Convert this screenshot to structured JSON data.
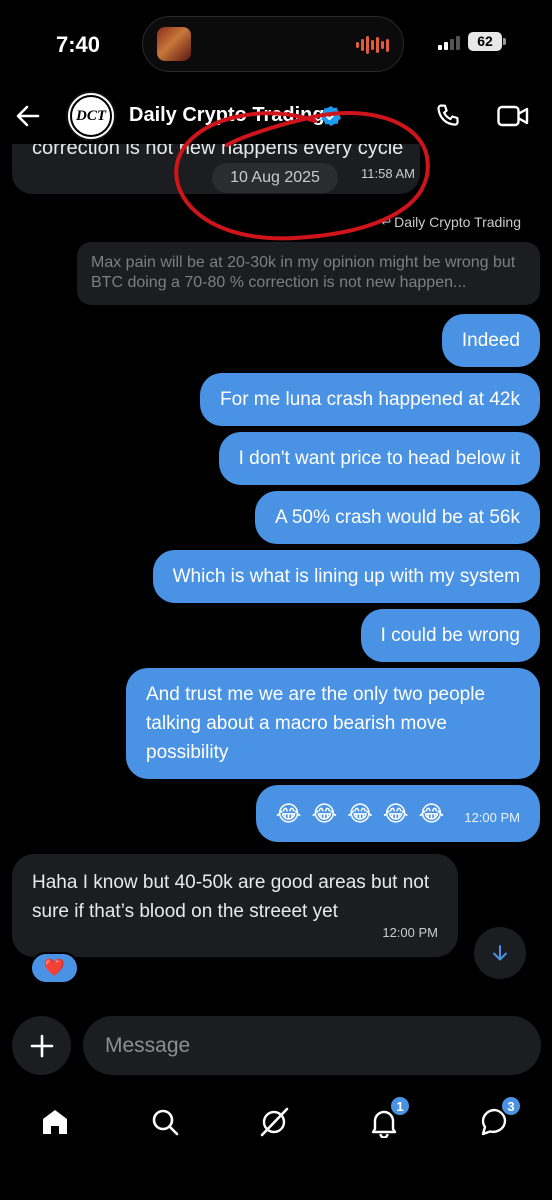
{
  "status_bar": {
    "time": "7:40",
    "battery": "62"
  },
  "header": {
    "back_icon": "back-arrow-icon",
    "avatar_text": "DCT",
    "title": "Daily Crypto Trading",
    "verified_icon": "verified-badge-icon",
    "call_icon": "phone-icon",
    "video_icon": "video-camera-icon"
  },
  "conversation": {
    "previous_message_fragment": "correction is not new happens every cycle",
    "date_separator": "10 Aug 2025",
    "previous_message_time": "11:58 AM",
    "reply": {
      "replying_to": "Daily Crypto Trading",
      "quoted_text": "Max pain will be at 20-30k in my opinion might be wrong but BTC doing a 70-80 % correction is not new happen..."
    },
    "outgoing_messages": [
      "Indeed",
      "For me luna crash happened at 42k",
      "I don't want price to head below it",
      "A 50% crash would be at 56k",
      "Which is what is lining up with my system",
      "I could be wrong",
      "And trust me we are the only two people talking about a macro bearish move possibility"
    ],
    "emoji_message": {
      "emojis": [
        "😂",
        "😂",
        "😂",
        "😂",
        "😂"
      ],
      "time": "12:00 PM"
    },
    "incoming_message": {
      "text": "Haha I know but 40-50k are good areas but not sure if that’s blood on the streeet yet",
      "time": "12:00 PM",
      "reaction": "❤️"
    }
  },
  "composer": {
    "placeholder": "Message",
    "plus_icon": "plus-icon",
    "scroll_down_icon": "arrow-down-icon"
  },
  "bottom_nav": {
    "items": [
      {
        "icon": "home-icon"
      },
      {
        "icon": "search-icon"
      },
      {
        "icon": "grok-icon"
      },
      {
        "icon": "bell-icon",
        "badge": "1"
      },
      {
        "icon": "messages-icon",
        "badge": "3"
      }
    ]
  },
  "colors": {
    "background": "#000000",
    "outgoing_bubble": "#4a93e4",
    "incoming_bubble": "#1c1d20",
    "annotation": "#d0141b"
  }
}
